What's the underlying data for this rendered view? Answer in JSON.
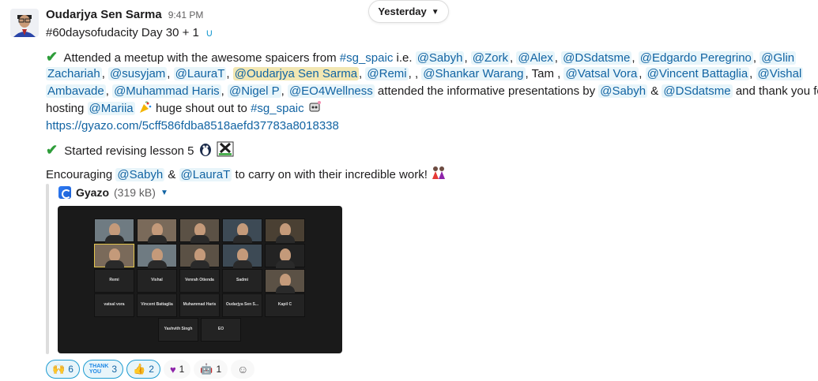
{
  "date_divider": "Yesterday",
  "message": {
    "author": "Oudarjya Sen Sarma",
    "time": "9:41 PM",
    "title_line": "#60daysofudacity Day 30 + 1",
    "line1": {
      "text1": "Attended a meetup with the awesome spaicers from ",
      "channel": "#sg_spaic",
      "text2": " i.e. ",
      "m1": "@Sabyh",
      "m2": "@Zork",
      "m3": "@Alex",
      "m4": "@DSdatsme",
      "m5": "@Edgardo Peregrino",
      "m6": "@Glin"
    },
    "line2": {
      "m1": "Zachariah",
      "m2": "@susyjam",
      "m3": "@LauraT",
      "m4": "@Oudarjya Sen Sarma",
      "m5": "@Remi",
      "m6": "@Shankar Warang",
      "tam": "Tam",
      "m7": "@Vatsal Vora",
      "m8": "@Vincent Battaglia",
      "m9": "@Vishal"
    },
    "line3": {
      "m1": "Ambavade",
      "m2": "@Muhammad Haris",
      "m3": "@Nigel P",
      "m4": "@EO4Wellness",
      "text1": " attended the informative presentations by ",
      "m5": "@Sabyh",
      "amp": " & ",
      "m6": "@DSdatsme",
      "text2": " and thank you for"
    },
    "line4": {
      "text1": "hosting ",
      "m1": "@Mariia",
      "text2": " huge shout out to ",
      "channel": "#sg_spaic"
    },
    "link": "https://gyazo.com/5cff586fdba8518aefd37783a8018338",
    "line5": "Started revising lesson 5",
    "line6": {
      "text1": "Encouraging ",
      "m1": "@Sabyh",
      "amp": " & ",
      "m2": "@LauraT",
      "text2": " to carry on with their incredible work!"
    }
  },
  "attachment": {
    "name": "Gyazo",
    "size": "(319 kB)",
    "tiles": [
      {
        "name": "Remi"
      },
      {
        "name": "Vishal"
      },
      {
        "name": "Venrah Otienda"
      },
      {
        "name": "Sadmi"
      },
      {
        "name": "vatsal vora"
      },
      {
        "name": "Vincent Battaglia"
      },
      {
        "name": "Muhammad Haris"
      },
      {
        "name": "Oudarjya Sen S..."
      },
      {
        "name": "Kapil C"
      },
      {
        "name": "Yashvith Singh"
      },
      {
        "name": "EO"
      }
    ]
  },
  "reactions": [
    {
      "icon": "raised-hands-icon",
      "count": "6"
    },
    {
      "icon": "thank-you-icon",
      "count": "3"
    },
    {
      "icon": "thumbs-up-icon",
      "count": "2"
    },
    {
      "icon": "purple-heart-icon",
      "count": "1"
    },
    {
      "icon": "robot-icon",
      "count": "1"
    }
  ],
  "colors": {
    "mention": "#1264a3",
    "mention_bg": "#e8f5fa",
    "self_mention_bg": "#f2e7b3",
    "check": "#2e9d3a"
  }
}
